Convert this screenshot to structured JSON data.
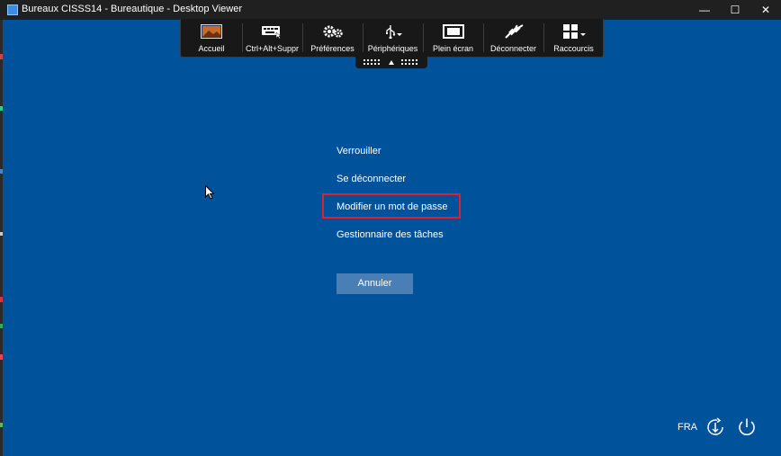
{
  "window": {
    "title": "Bureaux CISSS14 - Bureautique - Desktop Viewer"
  },
  "window_controls": {
    "minimize": "—",
    "maximize": "☐",
    "close": "✕"
  },
  "toolbar": {
    "items": [
      {
        "label": "Accueil",
        "icon": "home-thumbnail-icon"
      },
      {
        "label": "Ctrl+Alt+Suppr",
        "icon": "keyboard-icon"
      },
      {
        "label": "Préférences",
        "icon": "gear-icon"
      },
      {
        "label": "Périphériques",
        "icon": "usb-icon"
      },
      {
        "label": "Plein écran",
        "icon": "fullscreen-icon"
      },
      {
        "label": "Déconnecter",
        "icon": "plug-icon"
      },
      {
        "label": "Raccourcis",
        "icon": "grid-icon"
      }
    ]
  },
  "security_menu": {
    "items": [
      "Verrouiller",
      "Se déconnecter",
      "Modifier un mot de passe",
      "Gestionnaire des tâches"
    ],
    "highlighted_item": "Modifier un mot de passe",
    "cancel_label": "Annuler"
  },
  "tray": {
    "language": "FRA",
    "accessibility_icon": "ease-of-access-icon",
    "power_icon": "power-icon"
  },
  "colors": {
    "background": "#00529b",
    "highlight_border": "#e0202a",
    "button": "#4a7fb5",
    "titlebar": "#202020"
  }
}
